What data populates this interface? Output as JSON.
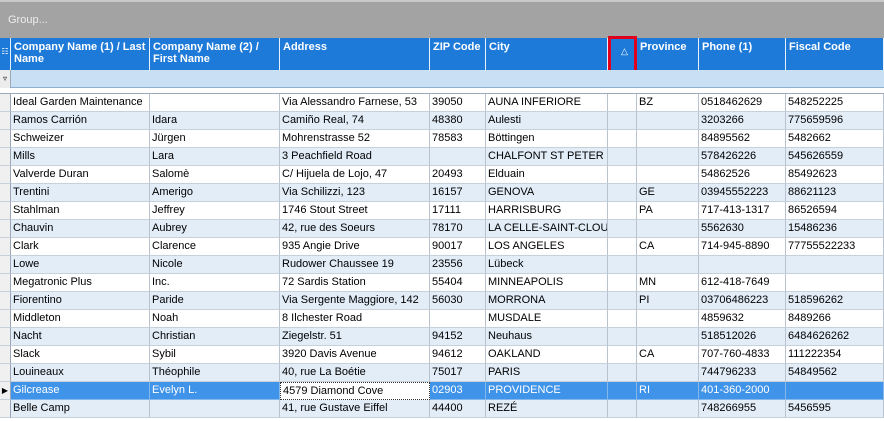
{
  "group_panel": {
    "label": "Group..."
  },
  "columns": [
    {
      "key": "company",
      "label": "Company Name (1) / Last Name"
    },
    {
      "key": "first",
      "label": "Company Name (2) / First Name"
    },
    {
      "key": "address",
      "label": "Address"
    },
    {
      "key": "zip",
      "label": "ZIP Code"
    },
    {
      "key": "city",
      "label": "City"
    },
    {
      "key": "sort",
      "label": "",
      "sort_direction": "ascending"
    },
    {
      "key": "province",
      "label": "Province"
    },
    {
      "key": "phone",
      "label": "Phone (1)"
    },
    {
      "key": "fiscal",
      "label": "Fiscal Code"
    }
  ],
  "icons": {
    "header": "grid-menu-icon",
    "filter": "filter-icon",
    "sort": "sort-ascending-icon",
    "row_pointer": "row-pointer-icon"
  },
  "rows": [
    [
      "Ideal Garden Maintenance",
      "",
      "Via Alessandro Farnese, 53",
      "39050",
      "AUNA INFERIORE",
      "BZ",
      "0518462629",
      "548252225"
    ],
    [
      "Ramos Carrión",
      "Idara",
      "Camiño Real, 74",
      "48380",
      "Aulesti",
      "",
      "3203266",
      "775659596"
    ],
    [
      "Schweizer",
      "Jürgen",
      "Mohrenstrasse 52",
      "78583",
      "Böttingen",
      "",
      "84895562",
      "5482662"
    ],
    [
      "Mills",
      "Lara",
      "3 Peachfield Road",
      "",
      "CHALFONT ST PETER",
      "",
      "578426226",
      "545626559"
    ],
    [
      "Valverde Duran",
      "Salomè",
      "C/ Hijuela de Lojo, 47",
      "20493",
      "Elduain",
      "",
      "54862526",
      "85492623"
    ],
    [
      "Trentini",
      "Amerigo",
      "Via Schilizzi, 123",
      "16157",
      "GENOVA",
      "GE",
      "03945552223",
      "88621123"
    ],
    [
      "Stahlman",
      "Jeffrey",
      "1746 Stout Street",
      "17111",
      "HARRISBURG",
      "PA",
      "717-413-1317",
      "86526594"
    ],
    [
      "Chauvin",
      "Aubrey",
      "42, rue des Soeurs",
      "78170",
      "LA CELLE-SAINT-CLOUD",
      "",
      "5562630",
      "15486236"
    ],
    [
      "Clark",
      "Clarence",
      "935 Angie Drive",
      "90017",
      "LOS ANGELES",
      "CA",
      "714-945-8890",
      "77755522233"
    ],
    [
      "Lowe",
      "Nicole",
      "Rudower Chaussee 19",
      "23556",
      "Lübeck",
      "",
      "",
      ""
    ],
    [
      "Megatronic Plus",
      "Inc.",
      "72 Sardis Station",
      "55404",
      "MINNEAPOLIS",
      "MN",
      "612-418-7649",
      ""
    ],
    [
      "Fiorentino",
      "Paride",
      "Via Sergente Maggiore, 142",
      "56030",
      "MORRONA",
      "PI",
      "03706486223",
      "518596262"
    ],
    [
      "Middleton",
      "Noah",
      "8 Ilchester Road",
      "",
      "MUSDALE",
      "",
      "4859632",
      "8489266"
    ],
    [
      "Nacht",
      "Christian",
      "Ziegelstr. 51",
      "94152",
      "Neuhaus",
      "",
      "518512026",
      "6484626262"
    ],
    [
      "Slack",
      "Sybil",
      "3920 Davis Avenue",
      "94612",
      "OAKLAND",
      "CA",
      "707-760-4833",
      "111222354"
    ],
    [
      "Louineaux",
      "Théophile",
      "40, rue La Boétie",
      "75017",
      "PARIS",
      "",
      "744796233",
      "54849562"
    ],
    [
      "Gilcrease",
      "Evelyn L.",
      "4579 Diamond Cove",
      "02903",
      "PROVIDENCE",
      "RI",
      "401-360-2000",
      ""
    ],
    [
      "Belle Camp",
      "",
      "41, rue Gustave Eiffel",
      "44400",
      "REZÉ",
      "",
      "748266955",
      "5456595"
    ]
  ],
  "selected_row": 16,
  "focused_cell": 2,
  "colors": {
    "header": "#1e7ad8",
    "alt_row": "#e2edf8",
    "selected_row": "#3f93e8",
    "sort_highlight": "#e0001b",
    "group_panel": "#a3a3a3"
  }
}
